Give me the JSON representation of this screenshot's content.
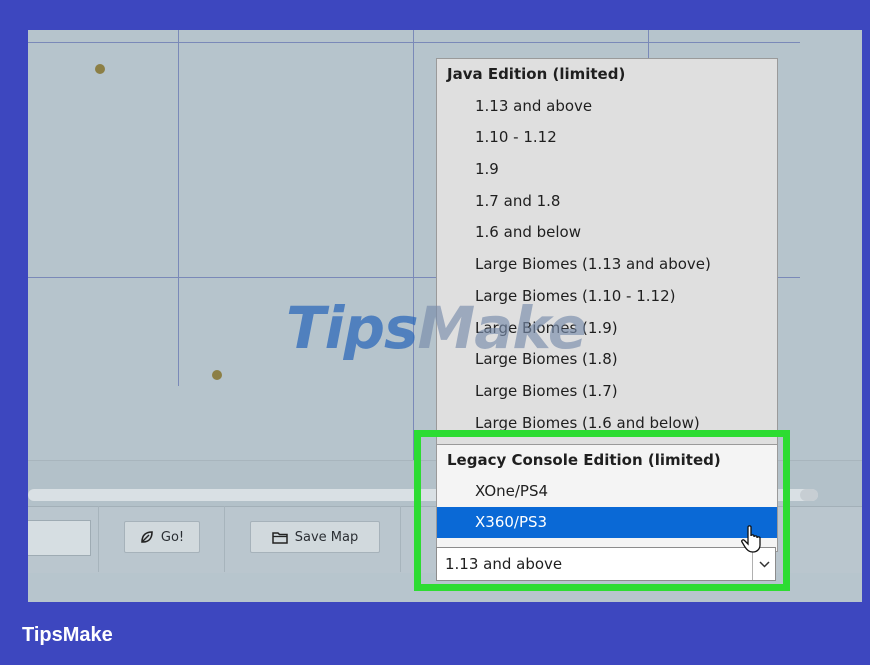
{
  "dropdown": {
    "groups": [
      {
        "label": "Java Edition (limited)",
        "items": [
          "1.13 and above",
          "1.10 - 1.12",
          "1.9",
          "1.7 and 1.8",
          "1.6 and below",
          "Large Biomes (1.13 and above)",
          "Large Biomes (1.10 - 1.12)",
          "Large Biomes (1.9)",
          "Large Biomes (1.8)",
          "Large Biomes (1.7)",
          "Large Biomes (1.6 and below)"
        ]
      },
      {
        "label": "Legacy Console Edition (limited)",
        "items": [
          "XOne/PS4",
          "X360/PS3"
        ],
        "selected": "X360/PS3"
      }
    ]
  },
  "select": {
    "value": "1.13 and above"
  },
  "toolbar": {
    "go_label": "Go!",
    "save_map_label": "Save Map"
  },
  "watermark": {
    "tips": "Tips",
    "make": "Make"
  },
  "footer": {
    "brand": "TipsMake"
  },
  "colors": {
    "highlight": "#2ddc32",
    "selection": "#0a69d6",
    "frame": "#3d47bf"
  },
  "icons": [
    "leaf-icon",
    "folder-icon",
    "chevron-down-icon",
    "mouse-cursor-icon"
  ]
}
